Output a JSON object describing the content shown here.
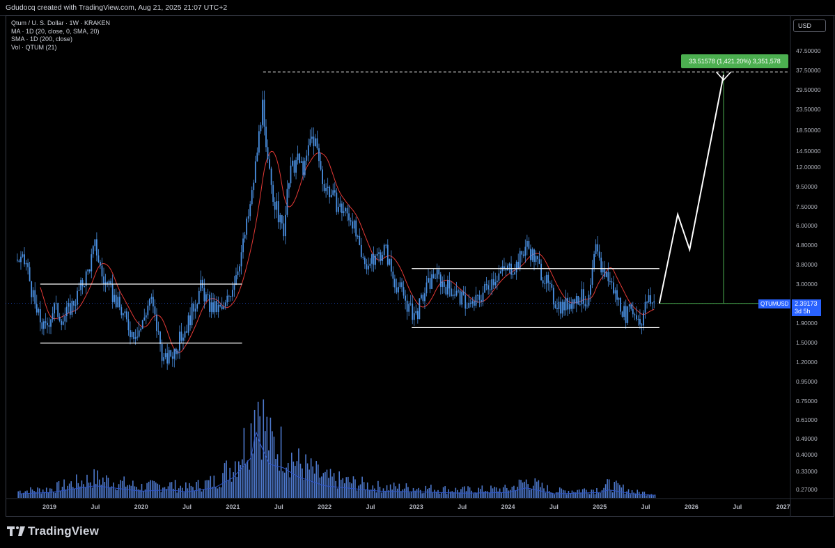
{
  "header": {
    "attribution": "Gdudocq created with TradingView.com, Aug 21, 2025 21:07 UTC+2"
  },
  "legend": {
    "symbol": "Qtum / U. S. Dollar · 1W · KRAKEN",
    "ma": "MA · 1D (20, close, 0, SMA, 20)",
    "sma": "SMA · 1D (200, close)",
    "vol": "Vol · QTUM (21)"
  },
  "currency_button": "USD",
  "price_tag": {
    "symbol": "QTUMUSD",
    "price": "2.39173",
    "countdown": "3d 5h"
  },
  "measure_label": "33.51578 (1,421.20%) 3,351,578",
  "brand": "TradingView",
  "colors": {
    "background": "#000000",
    "candle": "#4a90e2",
    "ma": "#e53935",
    "volume": "#5b8def",
    "volume_ma": "#2f54c4",
    "annotation": "#ffffff",
    "target": "#4caf50",
    "price_tag": "#2962ff"
  },
  "chart_data": {
    "type": "candlestick",
    "title": "Qtum / U. S. Dollar · 1W · KRAKEN",
    "y_scale": "log",
    "y_ticks": [
      "37.50000",
      "29.50000",
      "23.50000",
      "18.50000",
      "14.50000",
      "12.00000",
      "9.50000",
      "7.50000",
      "6.00000",
      "4.80000",
      "3.80000",
      "3.00000",
      "1.90000",
      "1.50000",
      "1.20000",
      "0.95000",
      "0.75000",
      "0.61000",
      "0.49000",
      "0.40000",
      "0.33000",
      "0.27000"
    ],
    "y_ticks_partial": [
      "47.50000"
    ],
    "price_tick_values": [
      37.5,
      29.5,
      23.5,
      18.5,
      14.5,
      12.0,
      9.5,
      7.5,
      6.0,
      4.8,
      3.8,
      3.0,
      1.9,
      1.5,
      1.2,
      0.95
    ],
    "x_ticks": [
      "2019",
      "Jul",
      "2020",
      "Jul",
      "2021",
      "Jul",
      "2022",
      "Jul",
      "2023",
      "Jul",
      "2024",
      "Jul",
      "2025",
      "Jul",
      "2026",
      "Jul",
      "2027"
    ],
    "x_tick_years": [
      2019.0,
      2019.5,
      2020.0,
      2020.5,
      2021.0,
      2021.5,
      2022.0,
      2022.5,
      2023.0,
      2023.5,
      2024.0,
      2024.5,
      2025.0,
      2025.5,
      2026.0,
      2026.5,
      2027.0
    ],
    "price_path": [
      [
        2018.65,
        4.0
      ],
      [
        2018.75,
        3.8
      ],
      [
        2018.85,
        2.2
      ],
      [
        2018.95,
        1.75
      ],
      [
        2019.05,
        2.3
      ],
      [
        2019.15,
        2.0
      ],
      [
        2019.3,
        2.6
      ],
      [
        2019.42,
        3.5
      ],
      [
        2019.5,
        4.8
      ],
      [
        2019.58,
        3.2
      ],
      [
        2019.7,
        2.6
      ],
      [
        2019.8,
        2.1
      ],
      [
        2019.9,
        1.7
      ],
      [
        2020.0,
        1.8
      ],
      [
        2020.1,
        2.6
      ],
      [
        2020.15,
        2.0
      ],
      [
        2020.25,
        1.2
      ],
      [
        2020.35,
        1.35
      ],
      [
        2020.5,
        1.85
      ],
      [
        2020.65,
        2.9
      ],
      [
        2020.75,
        2.3
      ],
      [
        2020.9,
        2.2
      ],
      [
        2021.0,
        3.0
      ],
      [
        2021.1,
        4.5
      ],
      [
        2021.2,
        8.0
      ],
      [
        2021.27,
        15.0
      ],
      [
        2021.32,
        25.0
      ],
      [
        2021.36,
        14.0
      ],
      [
        2021.45,
        8.0
      ],
      [
        2021.55,
        5.5
      ],
      [
        2021.62,
        11.0
      ],
      [
        2021.7,
        13.0
      ],
      [
        2021.78,
        11.5
      ],
      [
        2021.85,
        17.0
      ],
      [
        2021.9,
        16.0
      ],
      [
        2021.98,
        10.0
      ],
      [
        2022.05,
        9.0
      ],
      [
        2022.15,
        7.5
      ],
      [
        2022.3,
        6.5
      ],
      [
        2022.4,
        4.0
      ],
      [
        2022.5,
        3.8
      ],
      [
        2022.58,
        4.2
      ],
      [
        2022.66,
        4.6
      ],
      [
        2022.75,
        3.2
      ],
      [
        2022.85,
        2.7
      ],
      [
        2022.93,
        2.2
      ],
      [
        2023.0,
        2.1
      ],
      [
        2023.1,
        2.8
      ],
      [
        2023.2,
        3.4
      ],
      [
        2023.3,
        3.0
      ],
      [
        2023.4,
        2.8
      ],
      [
        2023.5,
        2.5
      ],
      [
        2023.6,
        2.3
      ],
      [
        2023.7,
        2.6
      ],
      [
        2023.8,
        3.1
      ],
      [
        2023.9,
        3.4
      ],
      [
        2024.0,
        3.6
      ],
      [
        2024.1,
        3.8
      ],
      [
        2024.2,
        4.8
      ],
      [
        2024.3,
        4.0
      ],
      [
        2024.4,
        3.2
      ],
      [
        2024.5,
        2.5
      ],
      [
        2024.6,
        2.3
      ],
      [
        2024.7,
        2.5
      ],
      [
        2024.8,
        2.6
      ],
      [
        2024.88,
        2.4
      ],
      [
        2024.95,
        4.5
      ],
      [
        2025.02,
        3.6
      ],
      [
        2025.1,
        3.2
      ],
      [
        2025.2,
        2.5
      ],
      [
        2025.28,
        2.1
      ],
      [
        2025.36,
        2.2
      ],
      [
        2025.45,
        1.95
      ],
      [
        2025.52,
        2.5
      ],
      [
        2025.6,
        2.39
      ]
    ],
    "volume_path": [
      [
        2018.65,
        0.06
      ],
      [
        2019.0,
        0.08
      ],
      [
        2019.5,
        0.18
      ],
      [
        2020.0,
        0.1
      ],
      [
        2020.3,
        0.12
      ],
      [
        2020.5,
        0.09
      ],
      [
        2020.8,
        0.15
      ],
      [
        2021.0,
        0.3
      ],
      [
        2021.1,
        0.45
      ],
      [
        2021.2,
        0.6
      ],
      [
        2021.25,
        1.0
      ],
      [
        2021.3,
        0.8
      ],
      [
        2021.4,
        0.5
      ],
      [
        2021.55,
        0.45
      ],
      [
        2021.7,
        0.32
      ],
      [
        2021.85,
        0.25
      ],
      [
        2022.0,
        0.18
      ],
      [
        2022.3,
        0.14
      ],
      [
        2022.6,
        0.1
      ],
      [
        2023.0,
        0.09
      ],
      [
        2023.5,
        0.07
      ],
      [
        2024.0,
        0.08
      ],
      [
        2024.2,
        0.15
      ],
      [
        2024.5,
        0.06
      ],
      [
        2025.0,
        0.08
      ],
      [
        2025.1,
        0.12
      ],
      [
        2025.4,
        0.05
      ],
      [
        2025.6,
        0.04
      ]
    ],
    "levels": {
      "range_2019_upper": 3.0,
      "range_2019_lower": 1.5,
      "range_2023_upper": 3.6,
      "range_2023_lower": 1.8,
      "target": 36.3,
      "current": 2.39173
    },
    "range_2019_years": [
      2018.9,
      2021.1
    ],
    "range_2023_years": [
      2022.95,
      2025.65
    ],
    "target_line_years": [
      2021.33,
      2027.05
    ],
    "projection_path": [
      [
        2025.65,
        2.39
      ],
      [
        2025.85,
        6.8
      ],
      [
        2025.98,
        4.5
      ],
      [
        2026.35,
        35.0
      ]
    ],
    "projection_arrow_base": [
      [
        2026.27,
        36.3
      ],
      [
        2026.35,
        33.0
      ],
      [
        2026.43,
        36.3
      ]
    ],
    "measure_line": {
      "year": 2026.35,
      "from": 2.39,
      "to": 36.3
    }
  }
}
